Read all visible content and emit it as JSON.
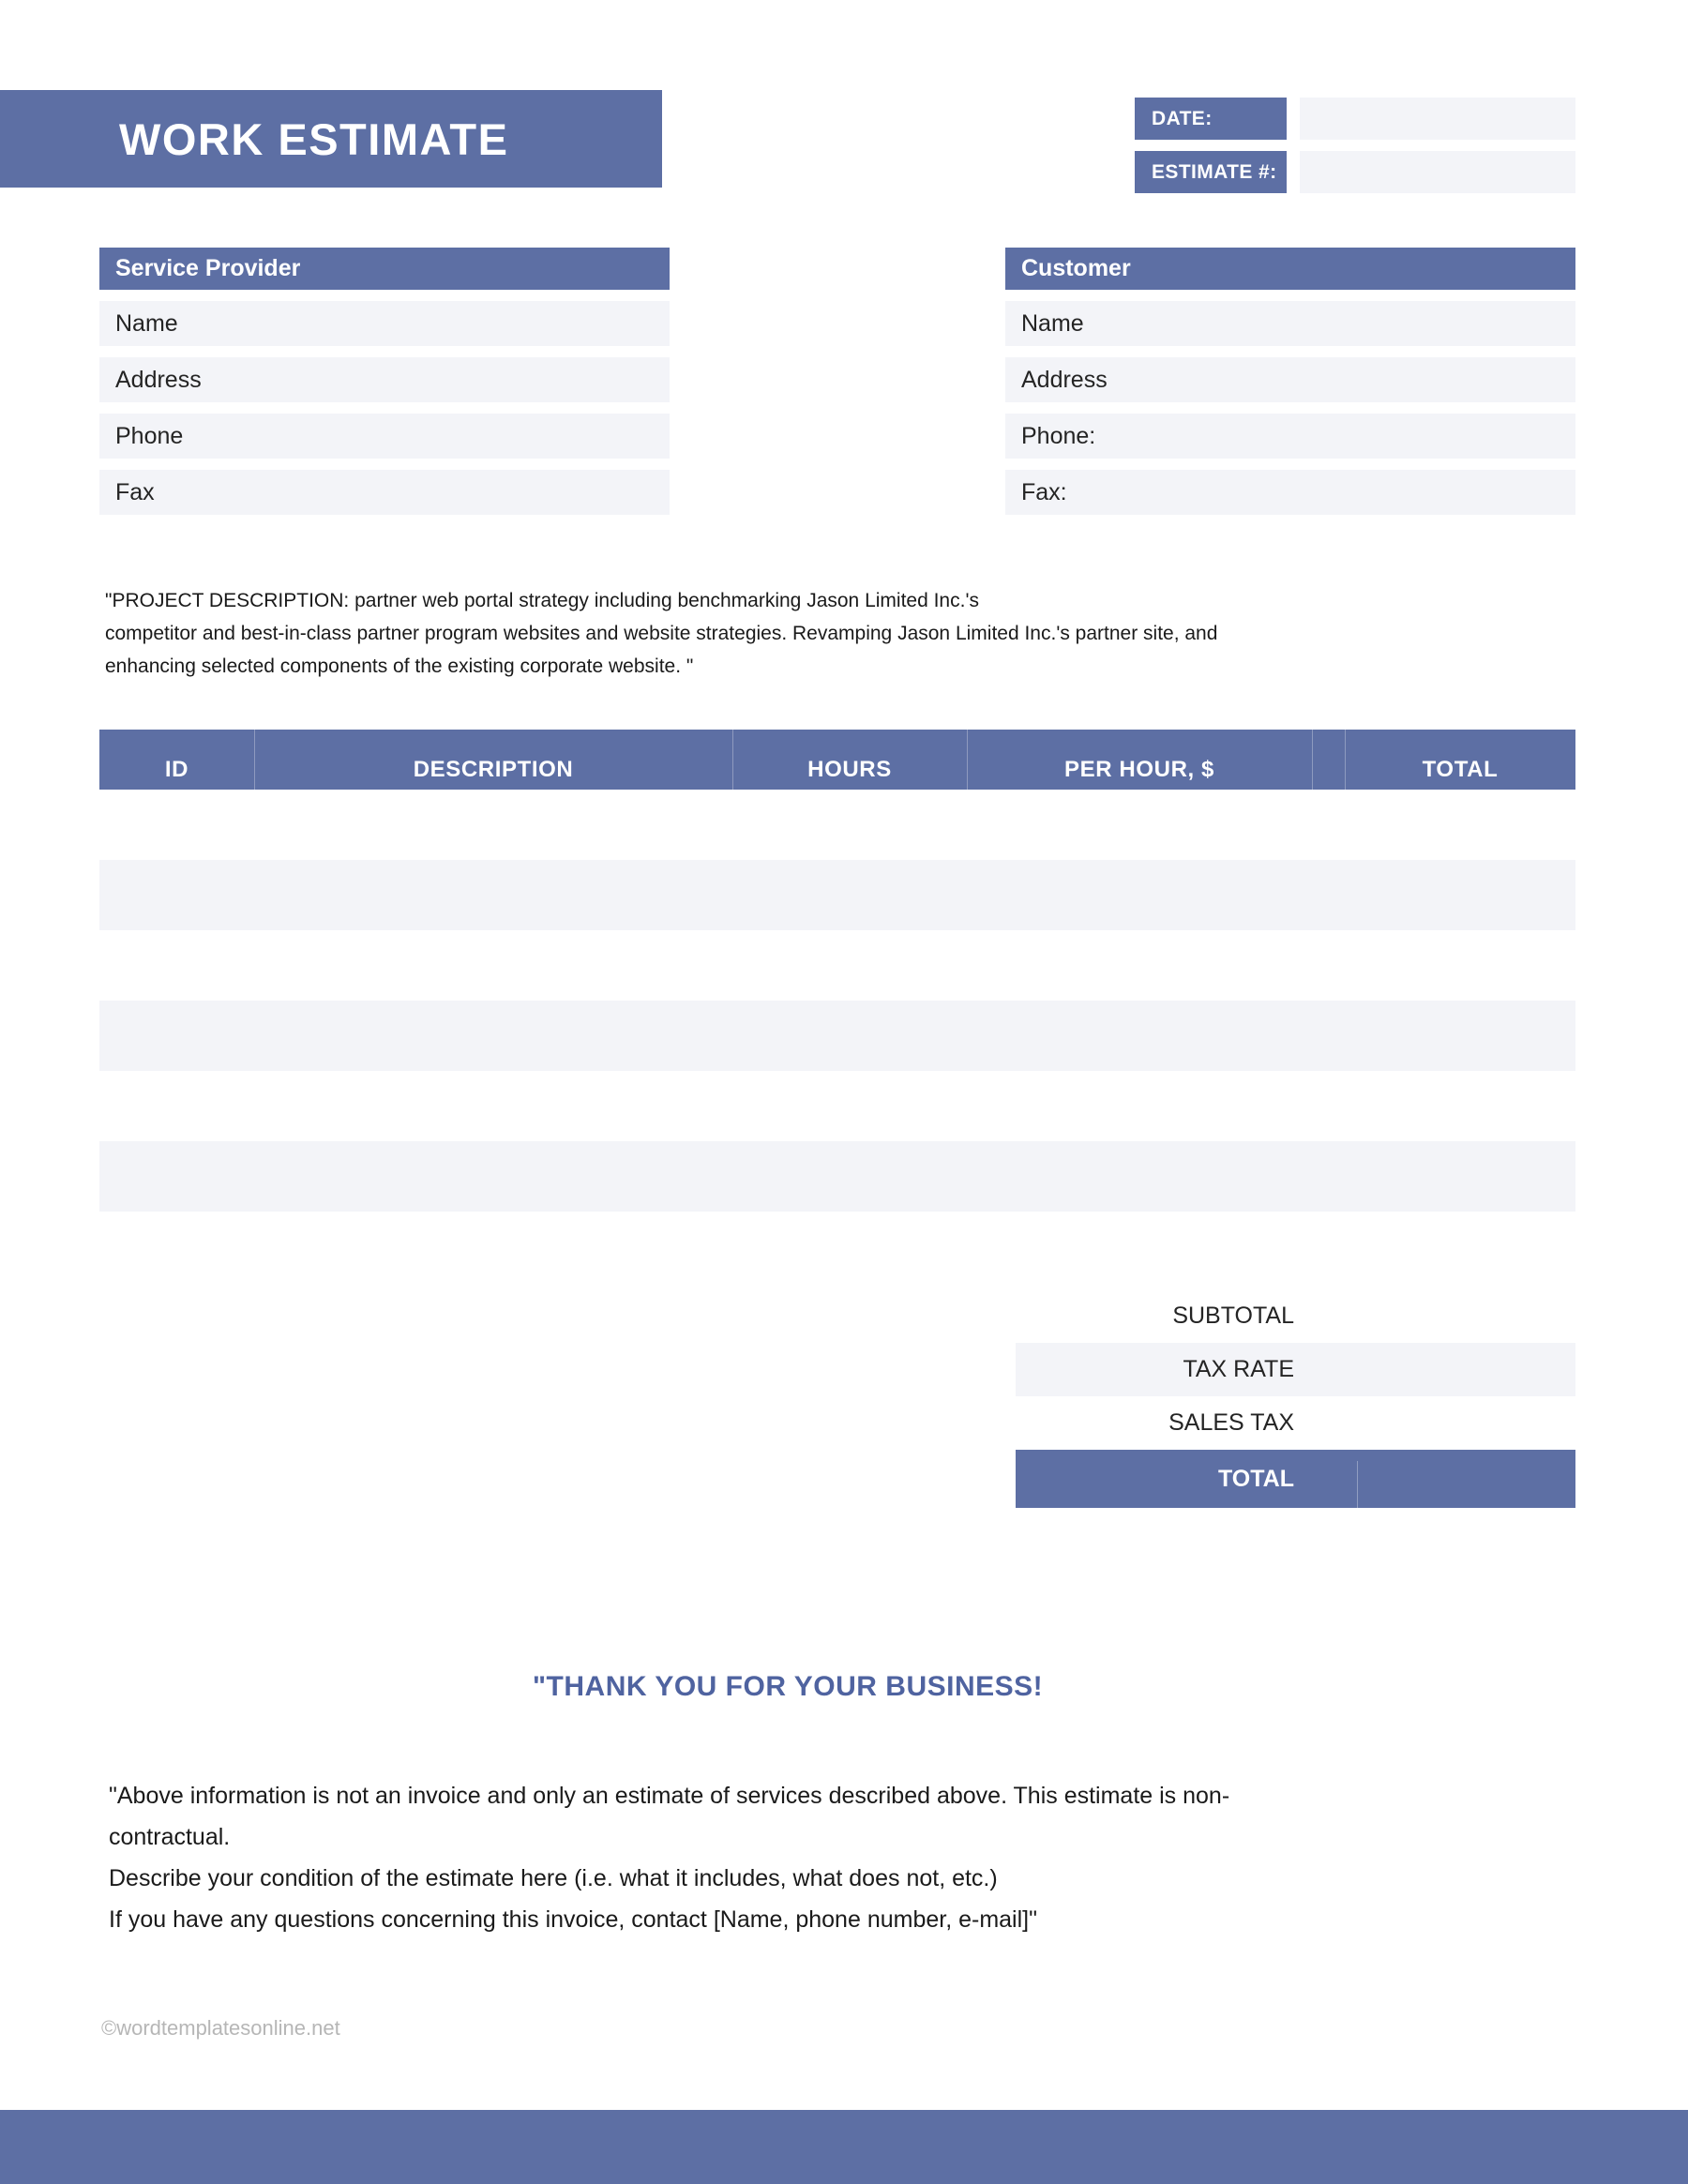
{
  "colors": {
    "accent": "#5d6fa4",
    "field": "#f3f4f8",
    "thankyou": "#4f63a0",
    "watermark": "#b6b6b6"
  },
  "header": {
    "title": "WORK ESTIMATE",
    "meta": [
      {
        "label": "DATE:",
        "value": ""
      },
      {
        "label": "ESTIMATE #:",
        "value": ""
      }
    ]
  },
  "service_provider": {
    "heading": "Service Provider",
    "fields": [
      {
        "label": "Name",
        "value": ""
      },
      {
        "label": "Address",
        "value": ""
      },
      {
        "label": "Phone",
        "value": ""
      },
      {
        "label": "Fax",
        "value": ""
      }
    ]
  },
  "customer": {
    "heading": "Customer",
    "fields": [
      {
        "label": "Name",
        "value": ""
      },
      {
        "label": "Address",
        "value": ""
      },
      {
        "label": "Phone:",
        "value": ""
      },
      {
        "label": "Fax:",
        "value": ""
      }
    ]
  },
  "project_description": {
    "line1": "\"PROJECT DESCRIPTION: partner web portal strategy including benchmarking Jason Limited Inc.'s",
    "line2": "competitor and best-in-class partner program websites and website strategies. Revamping Jason Limited Inc.'s partner site, and",
    "line3": "enhancing selected components of the existing corporate website. \""
  },
  "items_table": {
    "columns": [
      "ID",
      "DESCRIPTION",
      "HOURS",
      "PER HOUR, $",
      "TOTAL"
    ],
    "rows": [
      {
        "id": "",
        "description": "",
        "hours": "",
        "per_hour": "",
        "total": ""
      },
      {
        "id": "",
        "description": "",
        "hours": "",
        "per_hour": "",
        "total": ""
      },
      {
        "id": "",
        "description": "",
        "hours": "",
        "per_hour": "",
        "total": ""
      },
      {
        "id": "",
        "description": "",
        "hours": "",
        "per_hour": "",
        "total": ""
      },
      {
        "id": "",
        "description": "",
        "hours": "",
        "per_hour": "",
        "total": ""
      },
      {
        "id": "",
        "description": "",
        "hours": "",
        "per_hour": "",
        "total": ""
      },
      {
        "id": "",
        "description": "",
        "hours": "",
        "per_hour": "",
        "total": ""
      }
    ]
  },
  "totals": {
    "subtotal_label": "SUBTOTAL",
    "subtotal_value": "",
    "tax_rate_label": "TAX RATE",
    "tax_rate_value": "",
    "sales_tax_label": "SALES TAX",
    "sales_tax_value": "",
    "total_label": "TOTAL",
    "total_value": ""
  },
  "thank_you": "\"THANK YOU FOR YOUR BUSINESS!",
  "disclaimer": {
    "line1": "\"Above information is not an invoice and only an estimate of services described above. This estimate is non-",
    "line2": "contractual.",
    "line3": " Describe your condition of the estimate here (i.e. what it includes, what does not, etc.)",
    "line4": "If you have any questions concerning this invoice, contact [Name, phone number, e-mail]\""
  },
  "footer": {
    "watermark": "©wordtemplatesonline.net"
  }
}
